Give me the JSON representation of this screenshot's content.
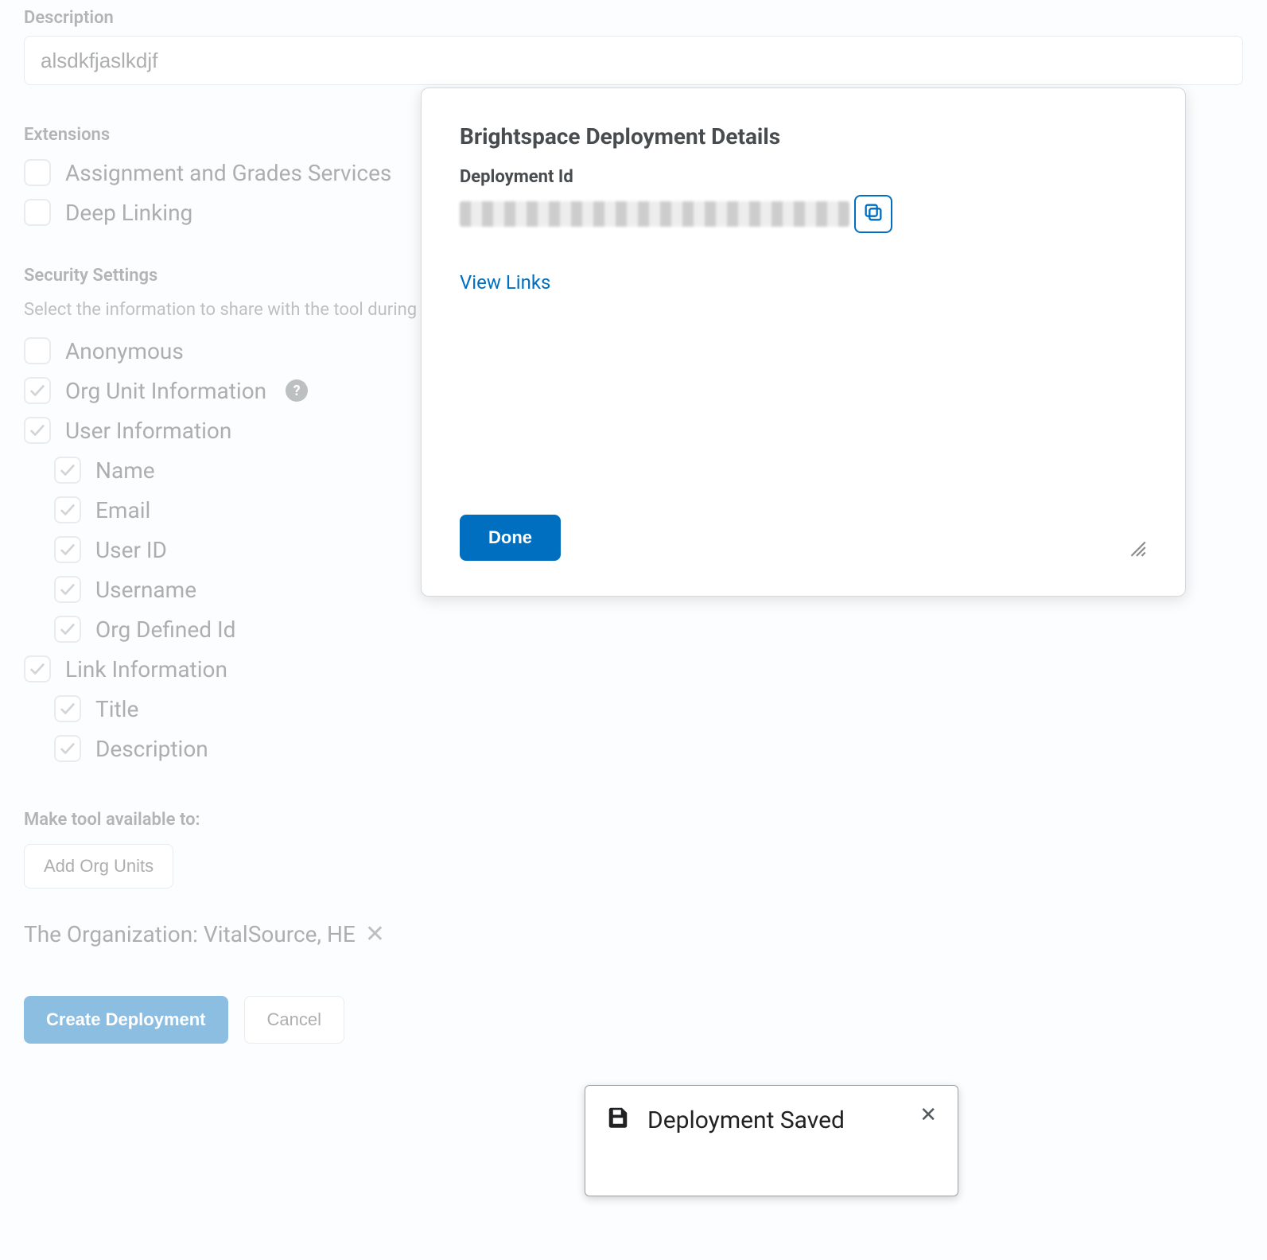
{
  "description": {
    "label": "Description",
    "value": "alsdkfjaslkdjf"
  },
  "extensions": {
    "label": "Extensions",
    "items": [
      {
        "key": "ags",
        "label": "Assignment and Grades Services",
        "checked": false
      },
      {
        "key": "deep",
        "label": "Deep Linking",
        "checked": false
      }
    ]
  },
  "security": {
    "label": "Security Settings",
    "help_text": "Select the information to share with the tool during launch.",
    "items": [
      {
        "key": "anon",
        "label": "Anonymous",
        "checked": false,
        "sub": false
      },
      {
        "key": "orgunit",
        "label": "Org Unit Information",
        "checked": true,
        "sub": false,
        "help": true
      },
      {
        "key": "userinf",
        "label": "User Information",
        "checked": true,
        "sub": false
      },
      {
        "key": "name",
        "label": "Name",
        "checked": true,
        "sub": true
      },
      {
        "key": "email",
        "label": "Email",
        "checked": true,
        "sub": true
      },
      {
        "key": "userid",
        "label": "User ID",
        "checked": true,
        "sub": true
      },
      {
        "key": "uname",
        "label": "Username",
        "checked": true,
        "sub": true
      },
      {
        "key": "orgdef",
        "label": "Org Defined Id",
        "checked": true,
        "sub": true
      },
      {
        "key": "linkinf",
        "label": "Link Information",
        "checked": true,
        "sub": false
      },
      {
        "key": "title",
        "label": "Title",
        "checked": true,
        "sub": true
      },
      {
        "key": "desc",
        "label": "Description",
        "checked": true,
        "sub": true
      }
    ]
  },
  "availability": {
    "label": "Make tool available to:",
    "add_button": "Add Org Units",
    "org_line": "The Organization: VitalSource, HE"
  },
  "footer": {
    "create": "Create Deployment",
    "cancel": "Cancel"
  },
  "modal": {
    "title": "Brightspace Deployment Details",
    "deployment_id_label": "Deployment Id",
    "view_links": "View Links",
    "done": "Done"
  },
  "toast": {
    "message": "Deployment Saved"
  }
}
